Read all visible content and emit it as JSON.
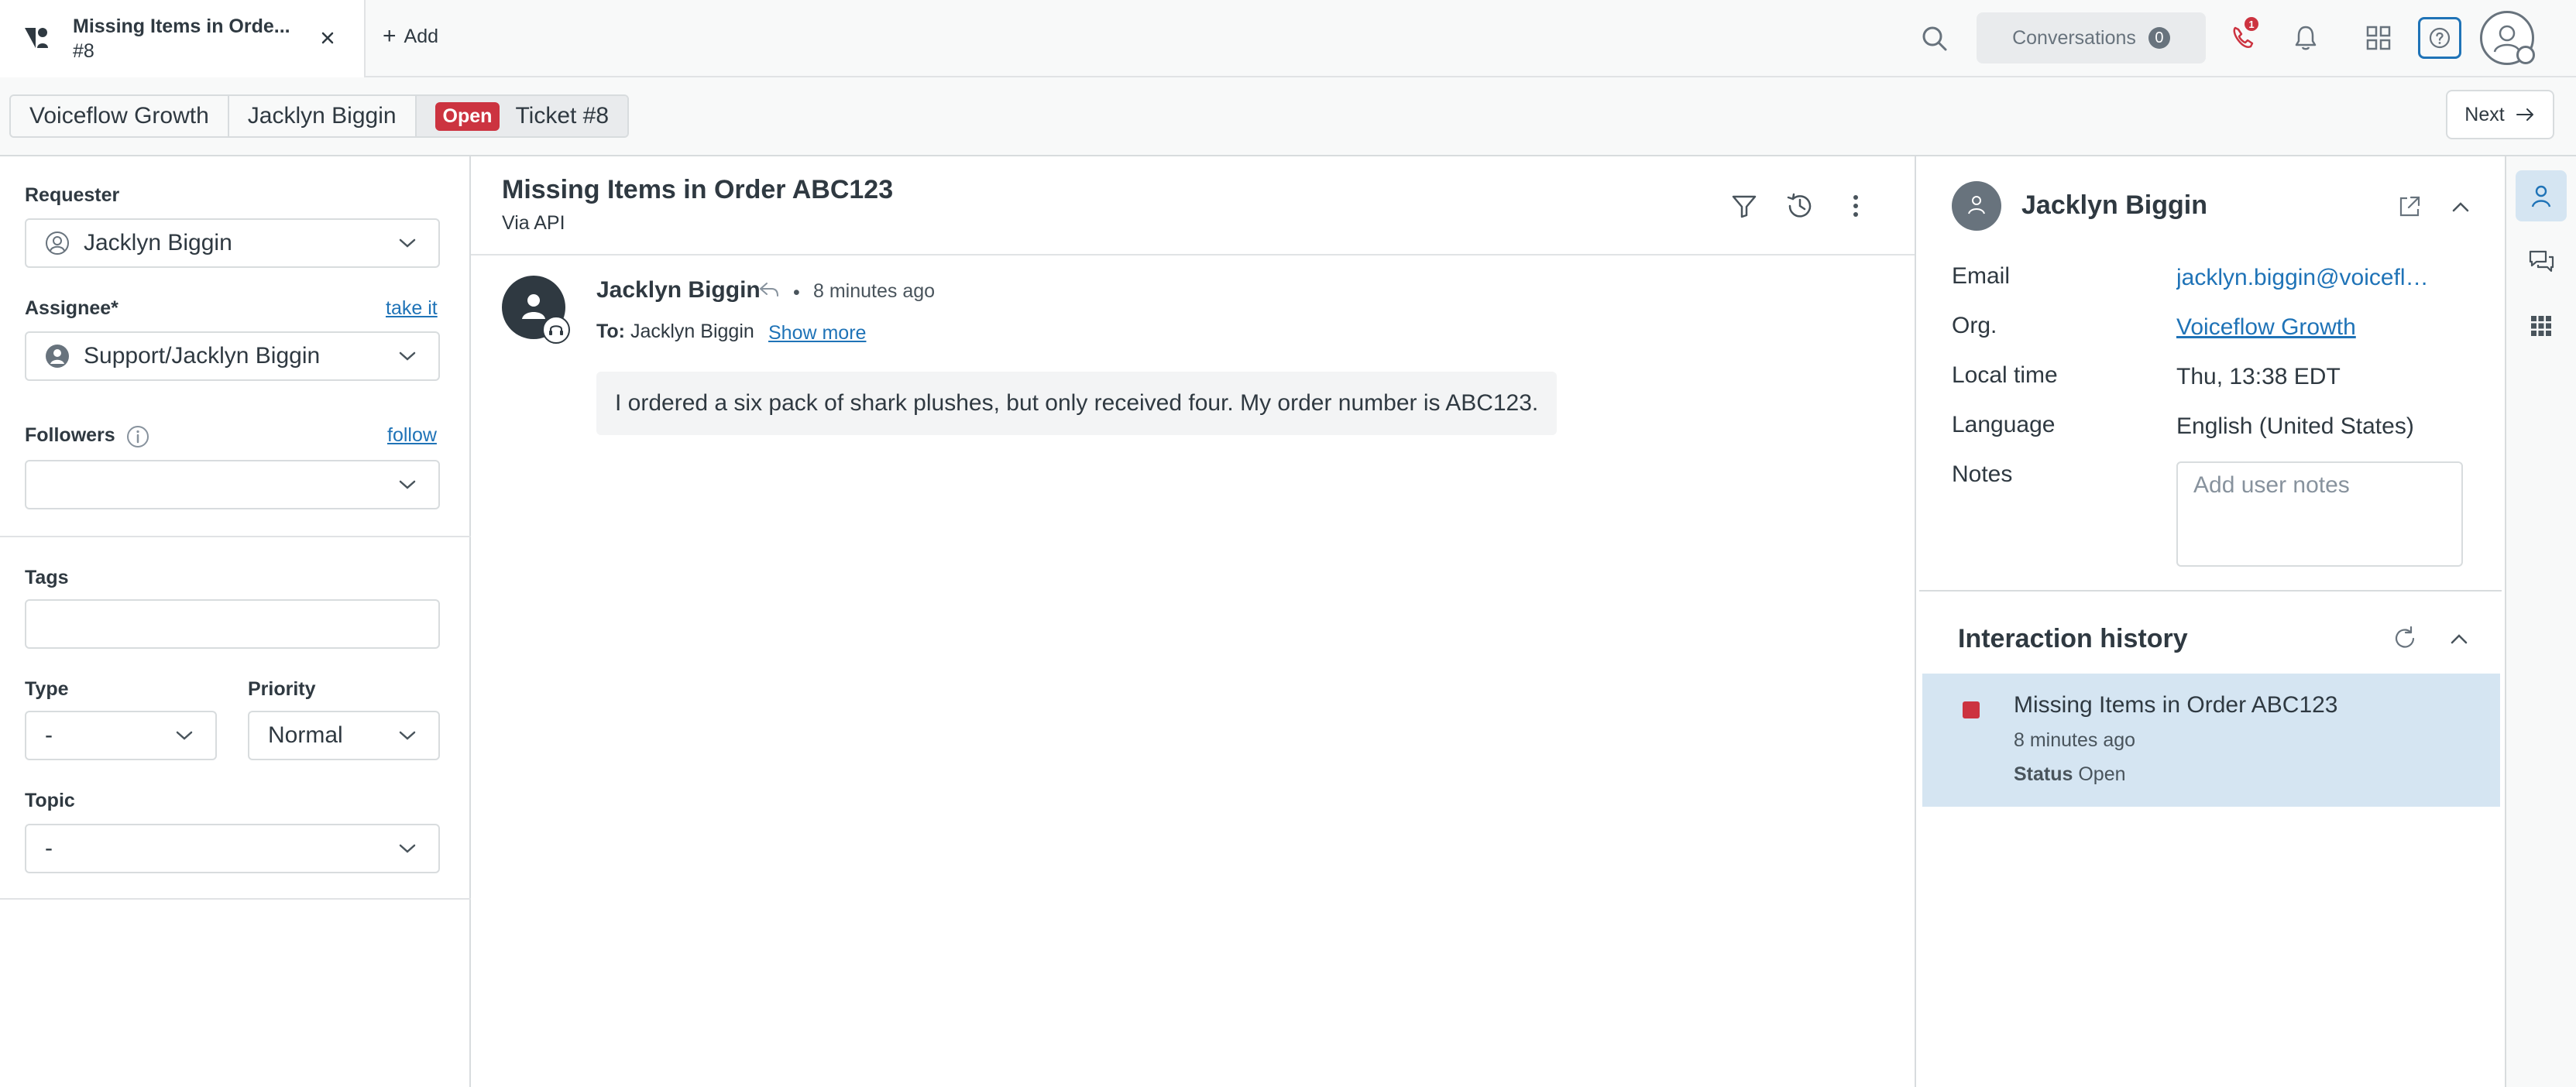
{
  "tab": {
    "title": "Missing Items in Orde...",
    "number": "#8"
  },
  "topbar": {
    "add_label": "Add",
    "conversations_label": "Conversations",
    "conversations_count": "0",
    "phone_badge": "1"
  },
  "breadcrumb": {
    "org": "Voiceflow Growth",
    "requester": "Jacklyn Biggin",
    "status": "Open",
    "ticket": "Ticket #8"
  },
  "next_label": "Next",
  "left": {
    "requester_label": "Requester",
    "requester_value": "Jacklyn Biggin",
    "assignee_label": "Assignee*",
    "take_it": "take it",
    "assignee_value": "Support/Jacklyn Biggin",
    "followers_label": "Followers",
    "follow": "follow",
    "tags_label": "Tags",
    "type_label": "Type",
    "type_value": "-",
    "priority_label": "Priority",
    "priority_value": "Normal",
    "topic_label": "Topic",
    "topic_value": "-"
  },
  "conversation": {
    "title": "Missing Items in Order ABC123",
    "via": "Via API",
    "author": "Jacklyn Biggin",
    "time": "8 minutes ago",
    "to_label": "To:",
    "to_value": "Jacklyn Biggin",
    "show_more": "Show more",
    "message": "I ordered a six pack of shark plushes, but only received four. My order number is ABC123."
  },
  "user_panel": {
    "name": "Jacklyn Biggin",
    "email_label": "Email",
    "email_value": "jacklyn.biggin@voiceflow...",
    "org_label": "Org.",
    "org_value": "Voiceflow Growth",
    "local_time_label": "Local time",
    "local_time_value": "Thu, 13:38 EDT",
    "language_label": "Language",
    "language_value": "English (United States)",
    "notes_label": "Notes",
    "notes_placeholder": "Add user notes",
    "history_title": "Interaction history",
    "history_item": {
      "title": "Missing Items in Order ABC123",
      "time": "8 minutes ago",
      "status_label": "Status",
      "status_value": "Open"
    }
  },
  "colors": {
    "accent": "#1f73b7",
    "danger": "#cc3340",
    "selected_bg": "#d5e5f2"
  }
}
